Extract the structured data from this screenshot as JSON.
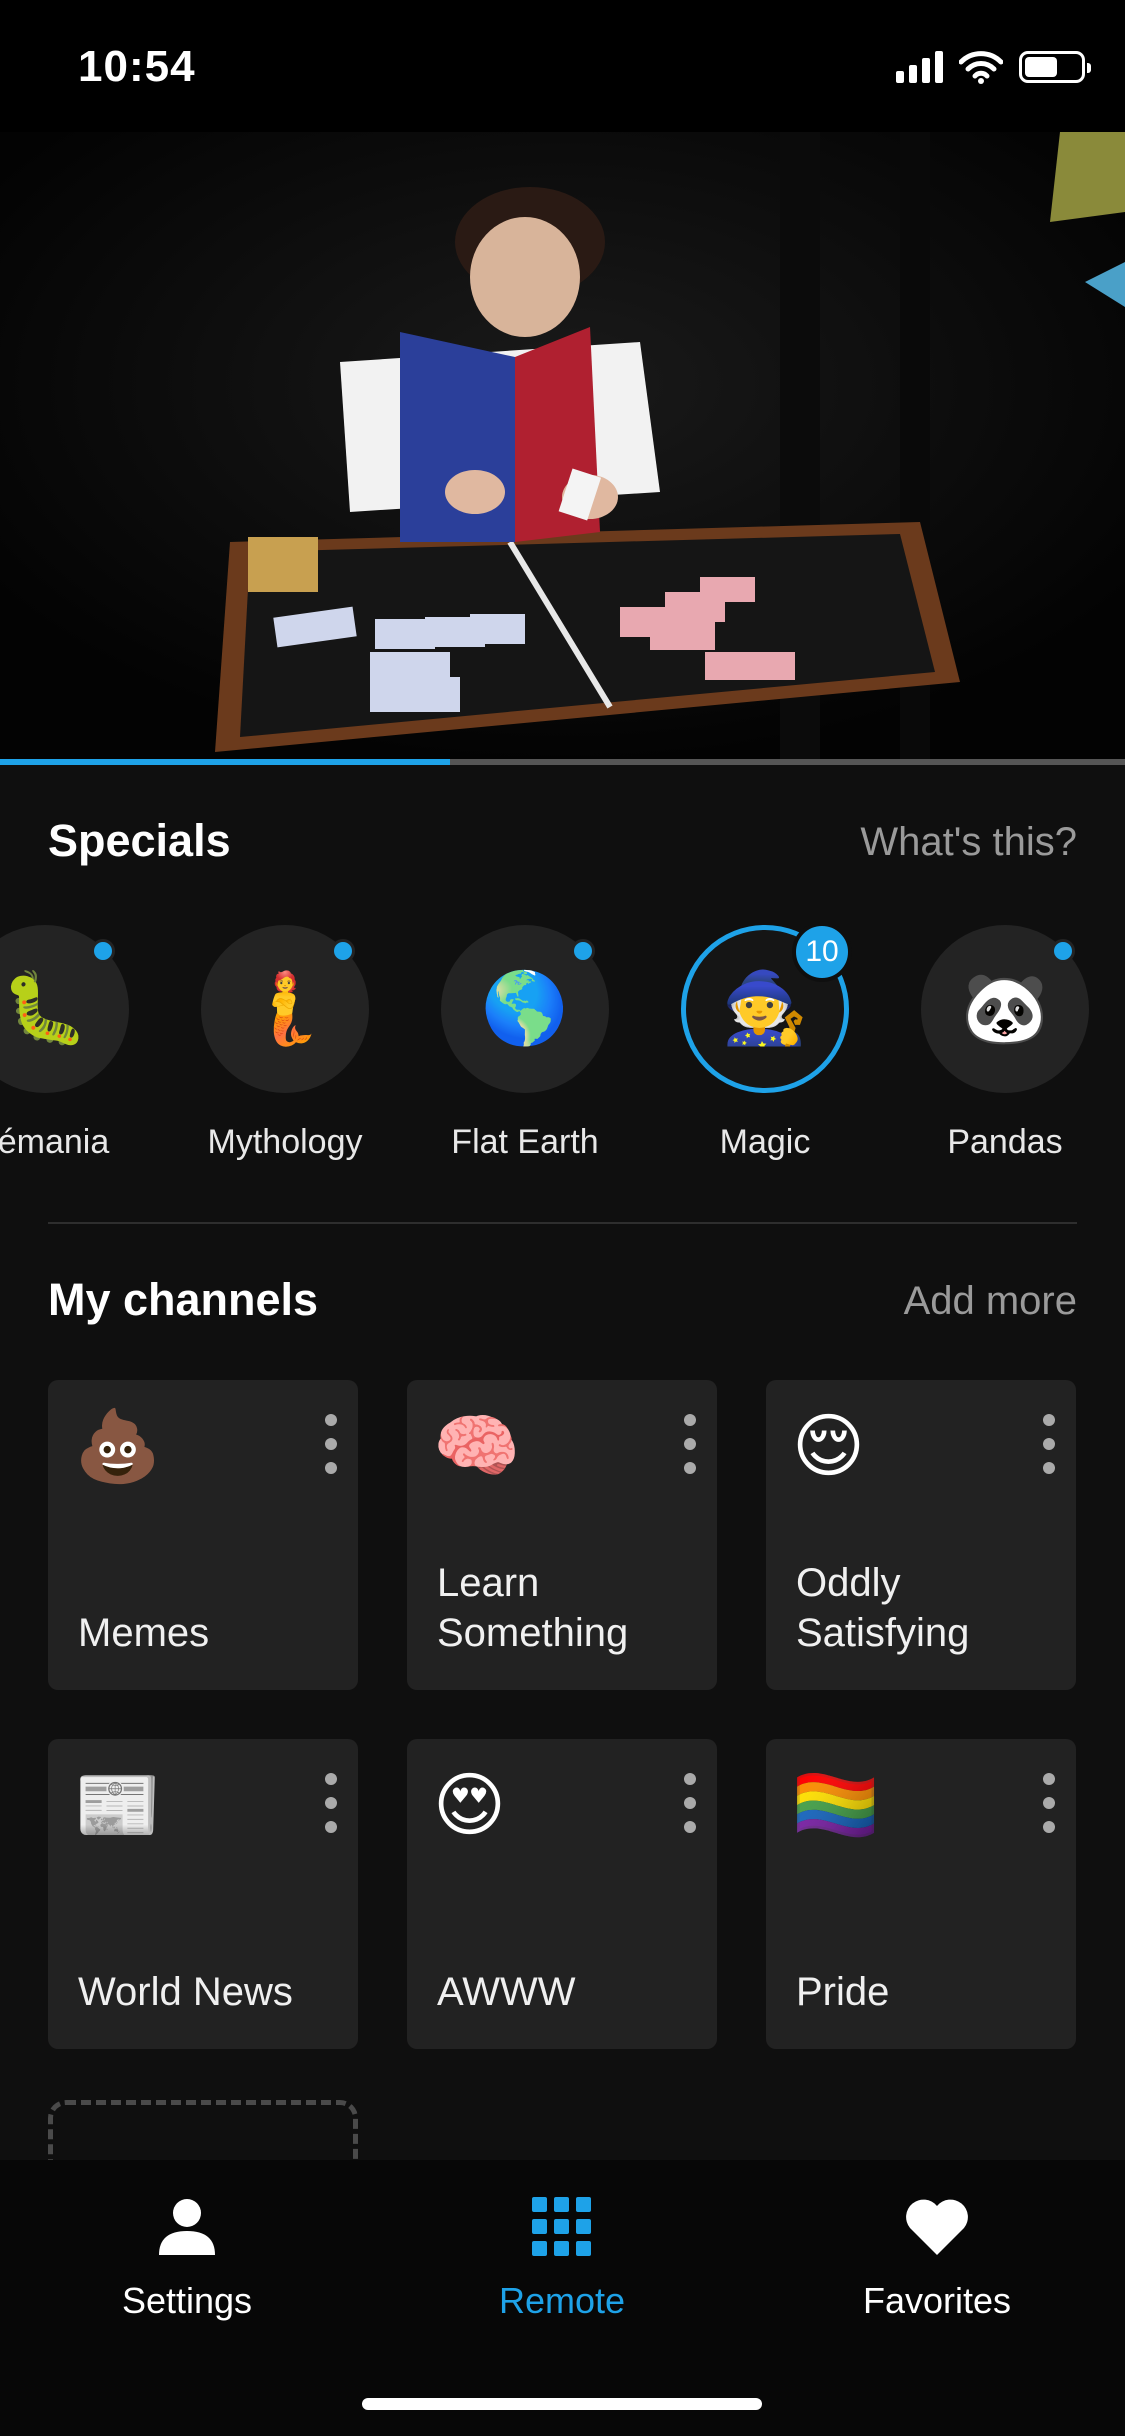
{
  "status_bar": {
    "time": "10:54"
  },
  "video": {
    "progress_fraction": 0.4
  },
  "specials": {
    "title": "Specials",
    "link": "What's this?",
    "items": [
      {
        "label": "kémania",
        "emoji": "🐛",
        "indicator": "dot"
      },
      {
        "label": "Mythology",
        "emoji": "🧜",
        "indicator": "dot"
      },
      {
        "label": "Flat Earth",
        "emoji": "🌎",
        "indicator": "dot"
      },
      {
        "label": "Magic",
        "emoji": "🧙",
        "indicator": "badge",
        "badge": "10",
        "selected": true
      },
      {
        "label": "Pandas",
        "emoji": "🐼",
        "indicator": "dot"
      }
    ]
  },
  "channels": {
    "title": "My channels",
    "link": "Add more",
    "items": [
      {
        "label": "Memes",
        "emoji": "💩"
      },
      {
        "label": "Learn Something",
        "emoji": "🧠"
      },
      {
        "label": "Oddly Satisfying",
        "emoji": "😌"
      },
      {
        "label": "World News",
        "emoji": "📰"
      },
      {
        "label": "AWWW",
        "emoji": "😍"
      },
      {
        "label": "Pride",
        "emoji": "🏳️‍🌈"
      }
    ]
  },
  "tabbar": {
    "settings": "Settings",
    "remote": "Remote",
    "favorites": "Favorites"
  },
  "colors": {
    "accent": "#1ea2e8",
    "background": "#0f0f0f",
    "card": "#222222"
  }
}
